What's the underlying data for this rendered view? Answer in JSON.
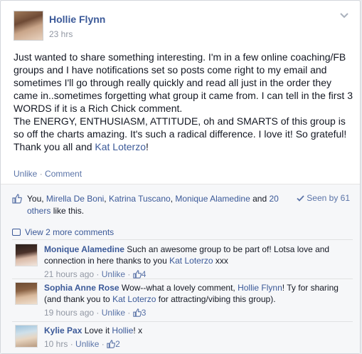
{
  "post": {
    "author": "Hollie Flynn",
    "time": "23 hrs",
    "text_part1": "Just wanted to share something interesting. I'm in a few online coaching/FB groups and I have notifications set so posts come right to my email and sometimes I'll go through really quickly and read all just in the order they came in..sometimes forgetting what group it came from. I can tell in the first 3 WORDS if it is a Rich Chick comment.",
    "text_part2": "The ENERGY, ENTHUSIASM, ATTITUDE, oh and SMARTS of this group is so off the charts amazing. It's such a radical difference. I love it! So grateful! Thank you all and ",
    "text_link": "Kat Loterzo",
    "text_end": "!",
    "unlike_label": "Unlike",
    "comment_label": "Comment",
    "separator": "·"
  },
  "likes": {
    "you": "You",
    "names": [
      "Mirella De Boni",
      "Katrina Tuscano",
      "Monique Alamedine"
    ],
    "and": " and ",
    "others_link": "20 others",
    "suffix": " like this.",
    "seen_by": "Seen by 61"
  },
  "comments_section": {
    "view_more": "View 2 more comments",
    "items": [
      {
        "name": "Monique Alamedine",
        "text": " Such an awesome group to be part of! Lotsa love and connection in here thanks to you ",
        "mention": "Kat Loterzo",
        "text_after": " xxx",
        "time": "21 hours ago",
        "unlike": "Unlike",
        "likes": "4"
      },
      {
        "name": "Sophia Anne Rose",
        "text": " Wow--what a lovely comment, ",
        "mention": "Hollie Flynn",
        "text_after": "! Ty for sharing (and thank you to ",
        "mention2": "Kat Loterzo",
        "text_after2": " for attracting/vibing this group).",
        "time": "19 hours ago",
        "unlike": "Unlike",
        "likes": "3"
      },
      {
        "name": "Kylie Pax",
        "text": " Love it ",
        "mention": "Hollie",
        "text_after": "! x",
        "time": "10 hrs",
        "unlike": "Unlike",
        "likes": "2"
      }
    ]
  },
  "colors": {
    "link": "#3b5998",
    "meta": "#9197a3",
    "background": "#f6f7f9"
  }
}
